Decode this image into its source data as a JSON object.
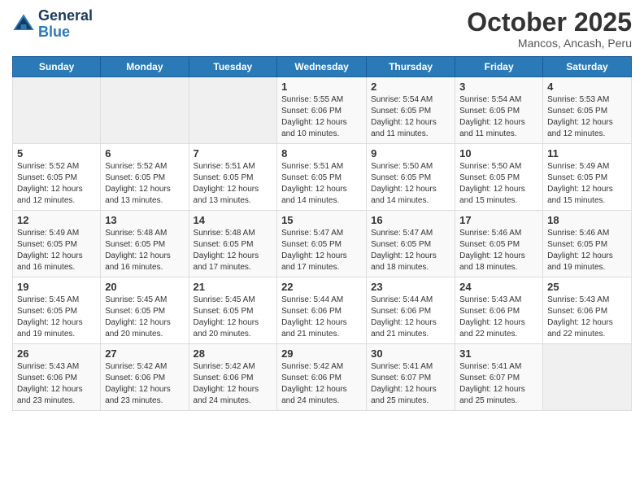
{
  "logo": {
    "line1": "General",
    "line2": "Blue"
  },
  "title": "October 2025",
  "location": "Mancos, Ancash, Peru",
  "days_header": [
    "Sunday",
    "Monday",
    "Tuesday",
    "Wednesday",
    "Thursday",
    "Friday",
    "Saturday"
  ],
  "weeks": [
    [
      {
        "day": "",
        "info": ""
      },
      {
        "day": "",
        "info": ""
      },
      {
        "day": "",
        "info": ""
      },
      {
        "day": "1",
        "info": "Sunrise: 5:55 AM\nSunset: 6:06 PM\nDaylight: 12 hours\nand 10 minutes."
      },
      {
        "day": "2",
        "info": "Sunrise: 5:54 AM\nSunset: 6:05 PM\nDaylight: 12 hours\nand 11 minutes."
      },
      {
        "day": "3",
        "info": "Sunrise: 5:54 AM\nSunset: 6:05 PM\nDaylight: 12 hours\nand 11 minutes."
      },
      {
        "day": "4",
        "info": "Sunrise: 5:53 AM\nSunset: 6:05 PM\nDaylight: 12 hours\nand 12 minutes."
      }
    ],
    [
      {
        "day": "5",
        "info": "Sunrise: 5:52 AM\nSunset: 6:05 PM\nDaylight: 12 hours\nand 12 minutes."
      },
      {
        "day": "6",
        "info": "Sunrise: 5:52 AM\nSunset: 6:05 PM\nDaylight: 12 hours\nand 13 minutes."
      },
      {
        "day": "7",
        "info": "Sunrise: 5:51 AM\nSunset: 6:05 PM\nDaylight: 12 hours\nand 13 minutes."
      },
      {
        "day": "8",
        "info": "Sunrise: 5:51 AM\nSunset: 6:05 PM\nDaylight: 12 hours\nand 14 minutes."
      },
      {
        "day": "9",
        "info": "Sunrise: 5:50 AM\nSunset: 6:05 PM\nDaylight: 12 hours\nand 14 minutes."
      },
      {
        "day": "10",
        "info": "Sunrise: 5:50 AM\nSunset: 6:05 PM\nDaylight: 12 hours\nand 15 minutes."
      },
      {
        "day": "11",
        "info": "Sunrise: 5:49 AM\nSunset: 6:05 PM\nDaylight: 12 hours\nand 15 minutes."
      }
    ],
    [
      {
        "day": "12",
        "info": "Sunrise: 5:49 AM\nSunset: 6:05 PM\nDaylight: 12 hours\nand 16 minutes."
      },
      {
        "day": "13",
        "info": "Sunrise: 5:48 AM\nSunset: 6:05 PM\nDaylight: 12 hours\nand 16 minutes."
      },
      {
        "day": "14",
        "info": "Sunrise: 5:48 AM\nSunset: 6:05 PM\nDaylight: 12 hours\nand 17 minutes."
      },
      {
        "day": "15",
        "info": "Sunrise: 5:47 AM\nSunset: 6:05 PM\nDaylight: 12 hours\nand 17 minutes."
      },
      {
        "day": "16",
        "info": "Sunrise: 5:47 AM\nSunset: 6:05 PM\nDaylight: 12 hours\nand 18 minutes."
      },
      {
        "day": "17",
        "info": "Sunrise: 5:46 AM\nSunset: 6:05 PM\nDaylight: 12 hours\nand 18 minutes."
      },
      {
        "day": "18",
        "info": "Sunrise: 5:46 AM\nSunset: 6:05 PM\nDaylight: 12 hours\nand 19 minutes."
      }
    ],
    [
      {
        "day": "19",
        "info": "Sunrise: 5:45 AM\nSunset: 6:05 PM\nDaylight: 12 hours\nand 19 minutes."
      },
      {
        "day": "20",
        "info": "Sunrise: 5:45 AM\nSunset: 6:05 PM\nDaylight: 12 hours\nand 20 minutes."
      },
      {
        "day": "21",
        "info": "Sunrise: 5:45 AM\nSunset: 6:05 PM\nDaylight: 12 hours\nand 20 minutes."
      },
      {
        "day": "22",
        "info": "Sunrise: 5:44 AM\nSunset: 6:06 PM\nDaylight: 12 hours\nand 21 minutes."
      },
      {
        "day": "23",
        "info": "Sunrise: 5:44 AM\nSunset: 6:06 PM\nDaylight: 12 hours\nand 21 minutes."
      },
      {
        "day": "24",
        "info": "Sunrise: 5:43 AM\nSunset: 6:06 PM\nDaylight: 12 hours\nand 22 minutes."
      },
      {
        "day": "25",
        "info": "Sunrise: 5:43 AM\nSunset: 6:06 PM\nDaylight: 12 hours\nand 22 minutes."
      }
    ],
    [
      {
        "day": "26",
        "info": "Sunrise: 5:43 AM\nSunset: 6:06 PM\nDaylight: 12 hours\nand 23 minutes."
      },
      {
        "day": "27",
        "info": "Sunrise: 5:42 AM\nSunset: 6:06 PM\nDaylight: 12 hours\nand 23 minutes."
      },
      {
        "day": "28",
        "info": "Sunrise: 5:42 AM\nSunset: 6:06 PM\nDaylight: 12 hours\nand 24 minutes."
      },
      {
        "day": "29",
        "info": "Sunrise: 5:42 AM\nSunset: 6:06 PM\nDaylight: 12 hours\nand 24 minutes."
      },
      {
        "day": "30",
        "info": "Sunrise: 5:41 AM\nSunset: 6:07 PM\nDaylight: 12 hours\nand 25 minutes."
      },
      {
        "day": "31",
        "info": "Sunrise: 5:41 AM\nSunset: 6:07 PM\nDaylight: 12 hours\nand 25 minutes."
      },
      {
        "day": "",
        "info": ""
      }
    ]
  ]
}
